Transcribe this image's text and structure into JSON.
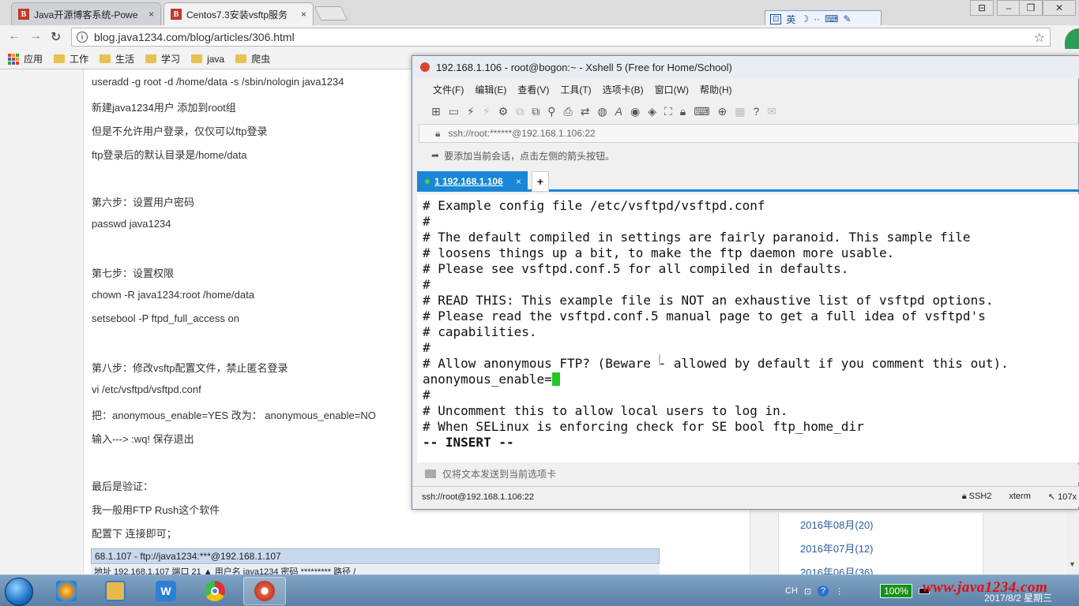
{
  "browser": {
    "tabs": [
      {
        "icon": "B",
        "title": "Java开源博客系统-Powe",
        "close": "×"
      },
      {
        "icon": "B",
        "title": "Centos7.3安装vsftp服务",
        "close": "×"
      }
    ],
    "url": "blog.java1234.com/blog/articles/306.html",
    "bookmarks": [
      {
        "label": "应用"
      },
      {
        "label": "工作"
      },
      {
        "label": "生活"
      },
      {
        "label": "学习"
      },
      {
        "label": "java"
      },
      {
        "label": "爬虫"
      }
    ],
    "ime_label": "英"
  },
  "article": {
    "lines": [
      "useradd -g root -d /home/data -s /sbin/nologin java1234",
      "新建java1234用户 添加到root组",
      "但是不允许用户登录，仅仅可以ftp登录",
      "ftp登录后的默认目录是/home/data",
      "第六步：设置用户密码",
      "passwd java1234",
      "第七步：设置权限",
      "chown -R java1234:root /home/data",
      "setsebool -P ftpd_full_access on",
      "第八步：修改vsftp配置文件，禁止匿名登录",
      "vi /etc/vsftpd/vsftpd.conf",
      "把：anonymous_enable=YES 改为： anonymous_enable=NO",
      "输入--->   :wq!  保存退出",
      "最后是验证：",
      "我一般用FTP Rush这个软件",
      "配置下 连接即可；"
    ],
    "ftp_bar": "68.1.107 - ftp://java1234:***@192.168.1.107",
    "ftp_fields": "地址 192.168.1.107    端口 21    ▲  用户名 java1234   密码 *********  路径 /"
  },
  "sidebar": {
    "archives": [
      "2016年08月(20)",
      "2016年07月(12)",
      "2016年06月(36)"
    ]
  },
  "xshell": {
    "title": "192.168.1.106 - root@bogon:~ - Xshell 5 (Free for Home/School)",
    "menu": [
      "文件(F)",
      "编辑(E)",
      "查看(V)",
      "工具(T)",
      "选项卡(B)",
      "窗口(W)",
      "帮助(H)"
    ],
    "address": "ssh://root:******@192.168.1.106:22",
    "hint": "要添加当前会话，点击左侧的箭头按钮。",
    "tab_label": "1 192.168.1.106",
    "tab_close": "×",
    "add_tab": "+",
    "terminal_lines": [
      "# Example config file /etc/vsftpd/vsftpd.conf",
      "#",
      "# The default compiled in settings are fairly paranoid. This sample file",
      "# loosens things up a bit, to make the ftp daemon more usable.",
      "# Please see vsftpd.conf.5 for all compiled in defaults.",
      "#",
      "# READ THIS: This example file is NOT an exhaustive list of vsftpd options.",
      "# Please read the vsftpd.conf.5 manual page to get a full idea of vsftpd's",
      "# capabilities.",
      "#",
      "# Allow anonymous FTP? (Beware - allowed by default if you comment this out).",
      "anonymous_enable=",
      "#",
      "# Uncomment this to allow local users to log in.",
      "# When SELinux is enforcing check for SE bool ftp_home_dir",
      "-- INSERT --"
    ],
    "compose_placeholder": "仅将文本发送到当前选项卡",
    "status_left": "ssh://root@192.168.1.106:22",
    "status_protocol": "SSH2",
    "status_term": "xterm",
    "status_size": "107x"
  },
  "taskbar": {
    "tray_lang": "CH",
    "battery": "100%",
    "watermark": "www.java1234.com",
    "clock": "2017/8/2 星期三"
  }
}
